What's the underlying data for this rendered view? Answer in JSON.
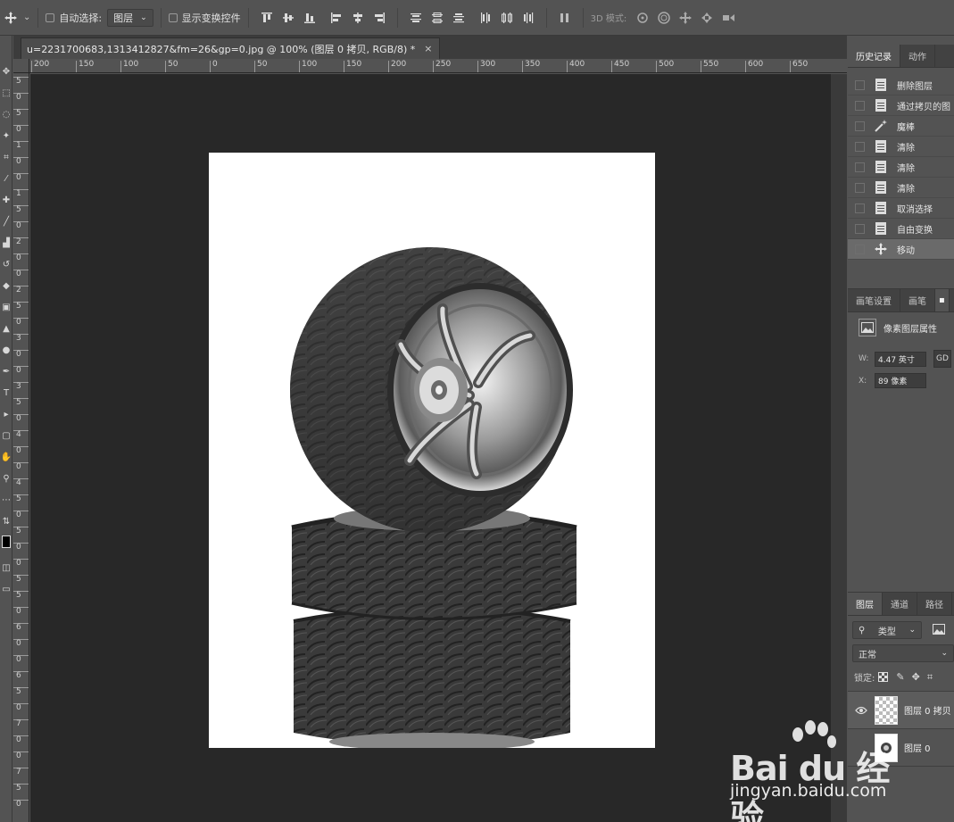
{
  "options_bar": {
    "auto_select_label": "自动选择:",
    "auto_select_value": "图层",
    "show_transform_label": "显示变换控件",
    "mode_3d_label": "3D 模式:"
  },
  "document": {
    "tab_title": "u=2231700683,1313412827&fm=26&gp=0.jpg @ 100% (图层 0 拷贝, RGB/8) *",
    "tab_close": "×"
  },
  "rulers": {
    "horizontal": [
      "200",
      "150",
      "100",
      "50",
      "0",
      "50",
      "100",
      "150",
      "200",
      "250",
      "300",
      "350",
      "400",
      "450",
      "500",
      "550",
      "600",
      "650"
    ],
    "vertical": [
      "5",
      "0",
      "5",
      "0",
      "1",
      "0",
      "0",
      "1",
      "5",
      "0",
      "2",
      "0",
      "0",
      "2",
      "5",
      "0",
      "3",
      "0",
      "0",
      "3",
      "5",
      "0",
      "4",
      "0",
      "0",
      "4",
      "5",
      "0",
      "5",
      "0",
      "0",
      "5",
      "5",
      "0",
      "6",
      "0",
      "0",
      "6",
      "5",
      "0",
      "7",
      "0",
      "0",
      "7",
      "5",
      "0"
    ]
  },
  "history_panel": {
    "tabs": [
      "历史记录",
      "动作"
    ],
    "items": [
      {
        "label": "删除图层",
        "icon": "doc-icon"
      },
      {
        "label": "通过拷贝的图",
        "icon": "doc-icon"
      },
      {
        "label": "魔棒",
        "icon": "magic-wand-icon"
      },
      {
        "label": "清除",
        "icon": "doc-icon"
      },
      {
        "label": "清除",
        "icon": "doc-icon"
      },
      {
        "label": "清除",
        "icon": "doc-icon"
      },
      {
        "label": "取消选择",
        "icon": "doc-icon"
      },
      {
        "label": "自由变换",
        "icon": "doc-icon"
      },
      {
        "label": "移动",
        "icon": "move-icon"
      }
    ]
  },
  "properties_panel": {
    "tabs": [
      "画笔设置",
      "画笔"
    ],
    "title": "像素图层属性",
    "w_label": "W:",
    "w_value": "4.47 英寸",
    "x_label": "X:",
    "x_value": "89 像素"
  },
  "layers_panel": {
    "tabs": [
      "图层",
      "通道",
      "路径"
    ],
    "filter_label": "类型",
    "blend_mode": "正常",
    "lock_label": "锁定:",
    "layers": [
      {
        "name": "图层 0 拷贝",
        "visible": true
      },
      {
        "name": "图层 0",
        "visible": false
      }
    ]
  },
  "watermark": {
    "logo": "Bai du 经验",
    "url": "jingyan.baidu.com"
  }
}
